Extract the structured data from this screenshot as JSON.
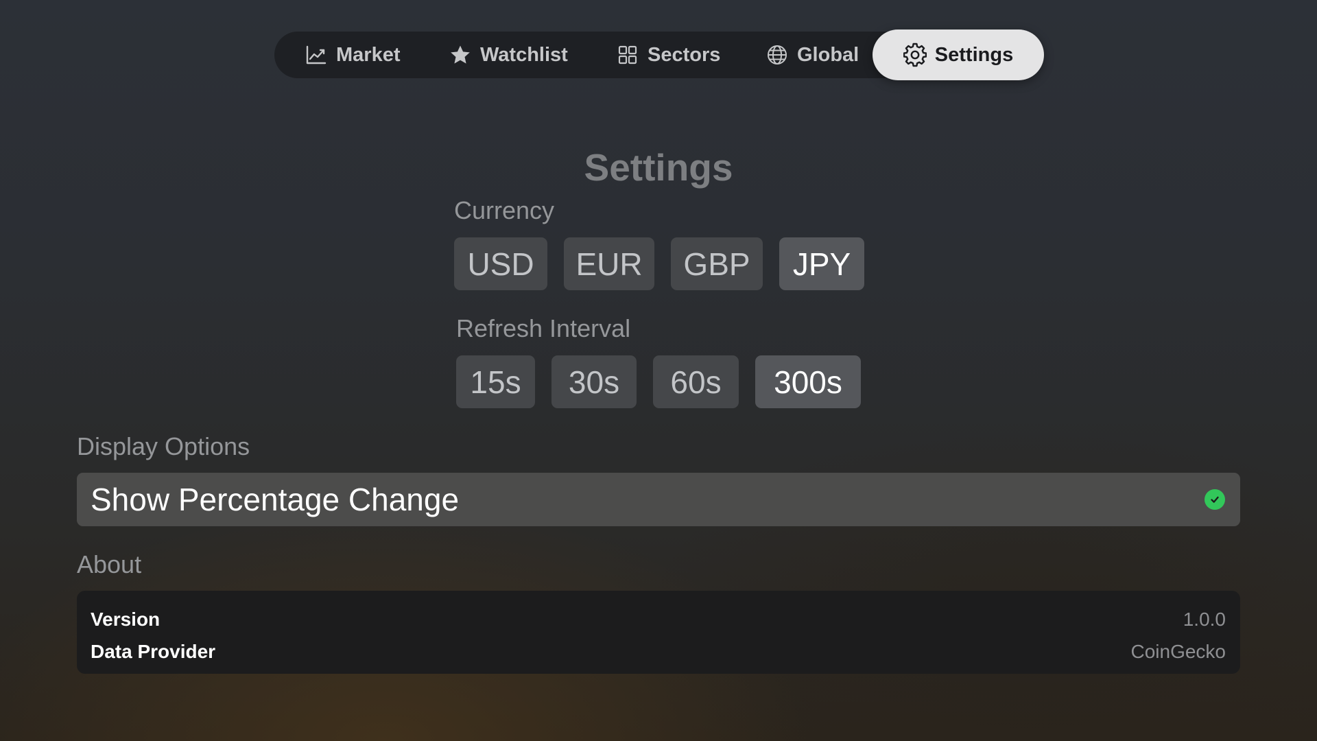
{
  "tabs": {
    "market": "Market",
    "watchlist": "Watchlist",
    "sectors": "Sectors",
    "global": "Global",
    "settings": "Settings",
    "active": "Settings"
  },
  "title": "Settings",
  "currency": {
    "label": "Currency",
    "options": [
      "USD",
      "EUR",
      "GBP",
      "JPY"
    ],
    "selected": "JPY"
  },
  "refresh": {
    "label": "Refresh Interval",
    "options": [
      "15s",
      "30s",
      "60s",
      "300s"
    ],
    "selected": "300s"
  },
  "display_options": {
    "label": "Display Options",
    "show_percentage_change": {
      "label": "Show Percentage Change",
      "checked": true
    }
  },
  "about": {
    "label": "About",
    "rows": [
      {
        "key": "Version",
        "value": "1.0.0"
      },
      {
        "key": "Data Provider",
        "value": "CoinGecko"
      }
    ]
  },
  "colors": {
    "check_green": "#32c75a",
    "selected_tab_bg": "#e4e4e5"
  },
  "icons": {
    "market": "chart-line-icon",
    "watchlist": "star-icon",
    "sectors": "grid-icon",
    "global": "globe-icon",
    "settings": "gear-icon",
    "checkmark": "checkmark-circle-icon"
  }
}
